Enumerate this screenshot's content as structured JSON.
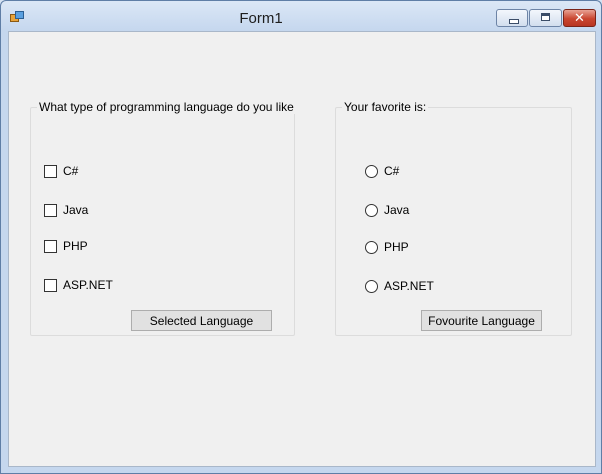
{
  "window": {
    "title": "Form1"
  },
  "checkbox_group": {
    "title": "What type of programming language do you like",
    "options": [
      "C#",
      "Java",
      "PHP",
      "ASP.NET"
    ],
    "button_label": "Selected Language"
  },
  "radio_group": {
    "title": "Your favorite is:",
    "options": [
      "C#",
      "Java",
      "PHP",
      "ASP.NET"
    ],
    "button_label": "Fovourite Language"
  },
  "colors": {
    "window_bg": "#f0f0f0",
    "close_button": "#c9452f",
    "titlebar": "#c5d7ee"
  }
}
